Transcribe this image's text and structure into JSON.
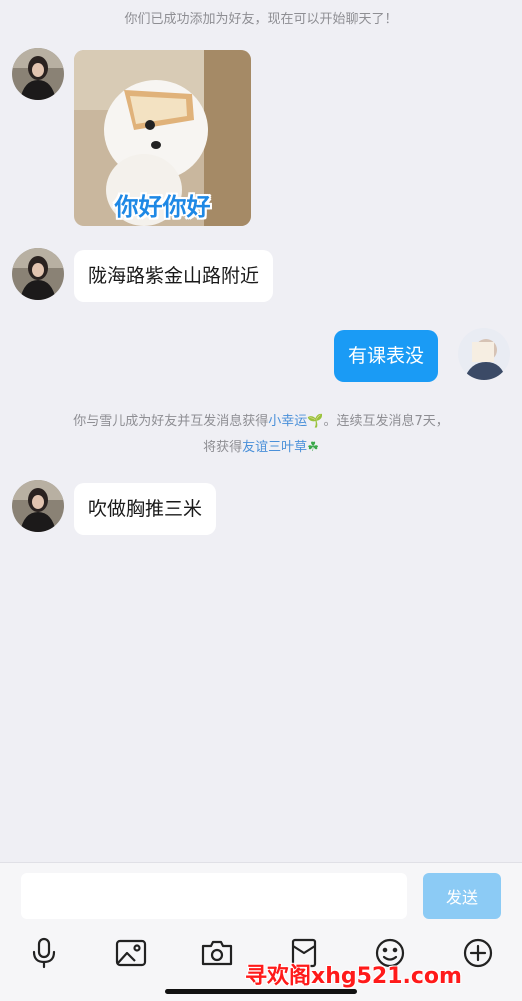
{
  "chat": {
    "system_added": "你们已成功添加为好友，现在可以开始聊天了！",
    "sticker_caption": "你好你好",
    "msg1": "陇海路紫金山路附近",
    "msg_me": "有课表没",
    "system_luck_part1": "你与雪儿成为好友并互发消息获得",
    "system_luck_link1": "小幸运",
    "system_luck_part2": "。连续互发消息7天，",
    "system_luck_part3": "将获得",
    "system_luck_link2": "友谊三叶草",
    "msg2": "吹做胸推三米"
  },
  "input_bar": {
    "placeholder": "",
    "send_label": "发送"
  },
  "toolbar": {
    "icons": [
      "microphone-icon",
      "image-icon",
      "camera-icon",
      "red-packet-icon",
      "emoji-icon",
      "plus-icon"
    ]
  },
  "watermark": "寻欢阁xhg521.com",
  "colors": {
    "background": "#efeff4",
    "my_bubble": "#1a9bf5",
    "send_button": "#8ccbf5",
    "link": "#4a90d9"
  }
}
